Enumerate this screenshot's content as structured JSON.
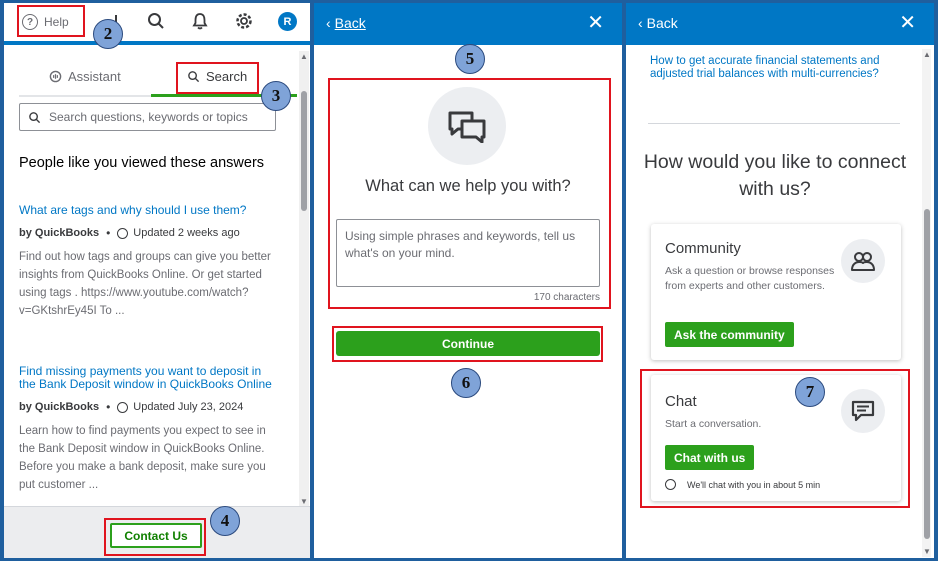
{
  "help_panel": {
    "help_label": "Help",
    "avatar_initial": "R",
    "tabs": [
      {
        "label": "Assistant"
      },
      {
        "label": "Search"
      }
    ],
    "search_placeholder": "Search questions, keywords or topics",
    "section_title": "People like you viewed these answers",
    "articles": [
      {
        "title": "What are tags and why should I use them?",
        "author": "by QuickBooks",
        "updated": "Updated 2 weeks ago",
        "excerpt": "Find out how tags and groups can give you better insights from QuickBooks Online. Or get started using tags . https://www.youtube.com/watch?v=GKtshrEy45I To ..."
      },
      {
        "title": "Find missing payments you want to deposit in the Bank Deposit window in QuickBooks Online",
        "author": "by QuickBooks",
        "updated": "Updated July 23, 2024",
        "excerpt": "Learn how to find payments you expect to see in the Bank Deposit window in QuickBooks Online. Before you make a bank deposit, make sure you put customer ..."
      }
    ],
    "contact_button": "Contact Us"
  },
  "question_panel": {
    "back_label": "Back",
    "question_title": "What can we help you with?",
    "textarea_placeholder": "Using simple phrases and keywords, tell us what's on your mind.",
    "char_count": "170 characters",
    "continue_button": "Continue"
  },
  "connect_panel": {
    "back_label": "Back",
    "top_link": "How to get accurate financial statements and adjusted trial balances with multi-currencies?",
    "connect_title": "How would you like to connect with us?",
    "community": {
      "title": "Community",
      "description": "Ask a question or browse responses from experts and other customers.",
      "button": "Ask the community"
    },
    "chat": {
      "title": "Chat",
      "description": "Start a conversation.",
      "button": "Chat with us",
      "wait_note": "We'll chat with you in about 5 min"
    }
  },
  "annotations": {
    "badges": [
      "2",
      "3",
      "4",
      "5",
      "6",
      "7"
    ]
  },
  "colors": {
    "brand_blue": "#0077c5",
    "brand_green": "#2ca01c",
    "highlight_red": "#e0141e"
  }
}
